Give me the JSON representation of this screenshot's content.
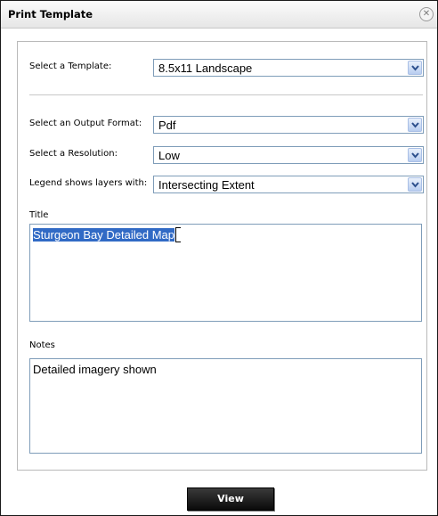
{
  "dialog": {
    "title": "Print Template",
    "close_icon": "close-circle-icon"
  },
  "form": {
    "template": {
      "label": "Select a Template:",
      "value": "8.5x11 Landscape"
    },
    "output_format": {
      "label": "Select an Output Format:",
      "value": "Pdf"
    },
    "resolution": {
      "label": "Select a Resolution:",
      "value": "Low"
    },
    "legend": {
      "label": "Legend shows layers with:",
      "value": "Intersecting Extent"
    },
    "title_field": {
      "label": "Title",
      "value": "Sturgeon Bay Detailed Map"
    },
    "notes_field": {
      "label": "Notes",
      "value": "Detailed imagery shown"
    }
  },
  "footer": {
    "view_label": "View"
  },
  "colors": {
    "selection": "#316ac5",
    "button_bg": "#111111",
    "input_border": "#7f9db9"
  }
}
